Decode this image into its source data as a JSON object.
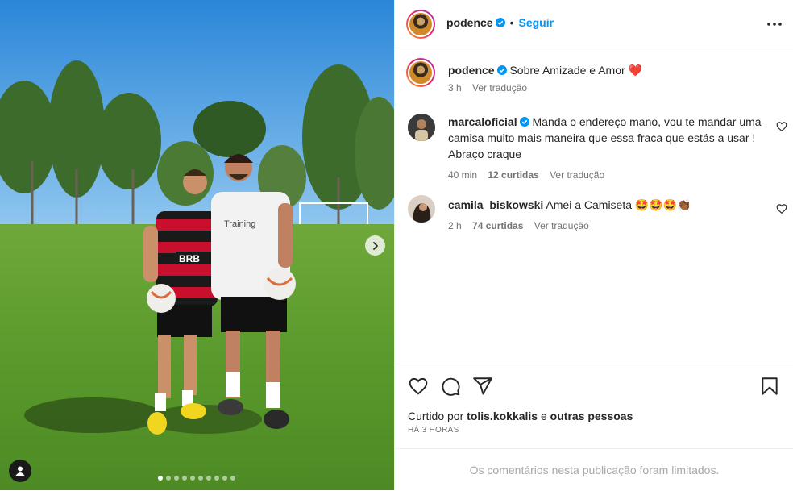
{
  "post": {
    "username": "podence",
    "follow_label": "Seguir",
    "separator": "•",
    "caption": "Sobre Amizade e Amor",
    "caption_emoji": "❤️",
    "caption_time": "3 h",
    "translate_label": "Ver tradução"
  },
  "comments": [
    {
      "username": "marcaloficial",
      "text": "Manda o endereço mano, vou te mandar uma camisa muito mais maneira que essa fraca que estás a usar ! Abraço craque",
      "time": "40 min",
      "likes": "12 curtidas",
      "translate": "Ver tradução"
    },
    {
      "username": "camila_biskowski",
      "text": "Amei a Camiseta",
      "emojis": "🤩🤩🤩👏🏾",
      "time": "2 h",
      "likes": "74 curtidas",
      "translate": "Ver tradução"
    }
  ],
  "likes": {
    "prefix": "Curtido por",
    "user": "tolis.kokkalis",
    "middle": "e",
    "others": "outras pessoas"
  },
  "post_time": "HÁ 3 HORAS",
  "comments_limited": "Os comentários nesta publicação foram limitados.",
  "icons": {
    "header_more": "more-horizontal-icon",
    "like": "heart-icon",
    "comment": "comment-icon",
    "share": "share-icon",
    "save": "bookmark-icon",
    "carousel_next": "chevron-right-icon",
    "tagged_user": "user-tag-icon"
  },
  "colors": {
    "accent": "#0095f6",
    "verified": "#0095f6",
    "text": "#262626",
    "secondary": "#737373",
    "muted": "#a8a8a8"
  },
  "carousel": {
    "total": 10,
    "current": 1
  }
}
